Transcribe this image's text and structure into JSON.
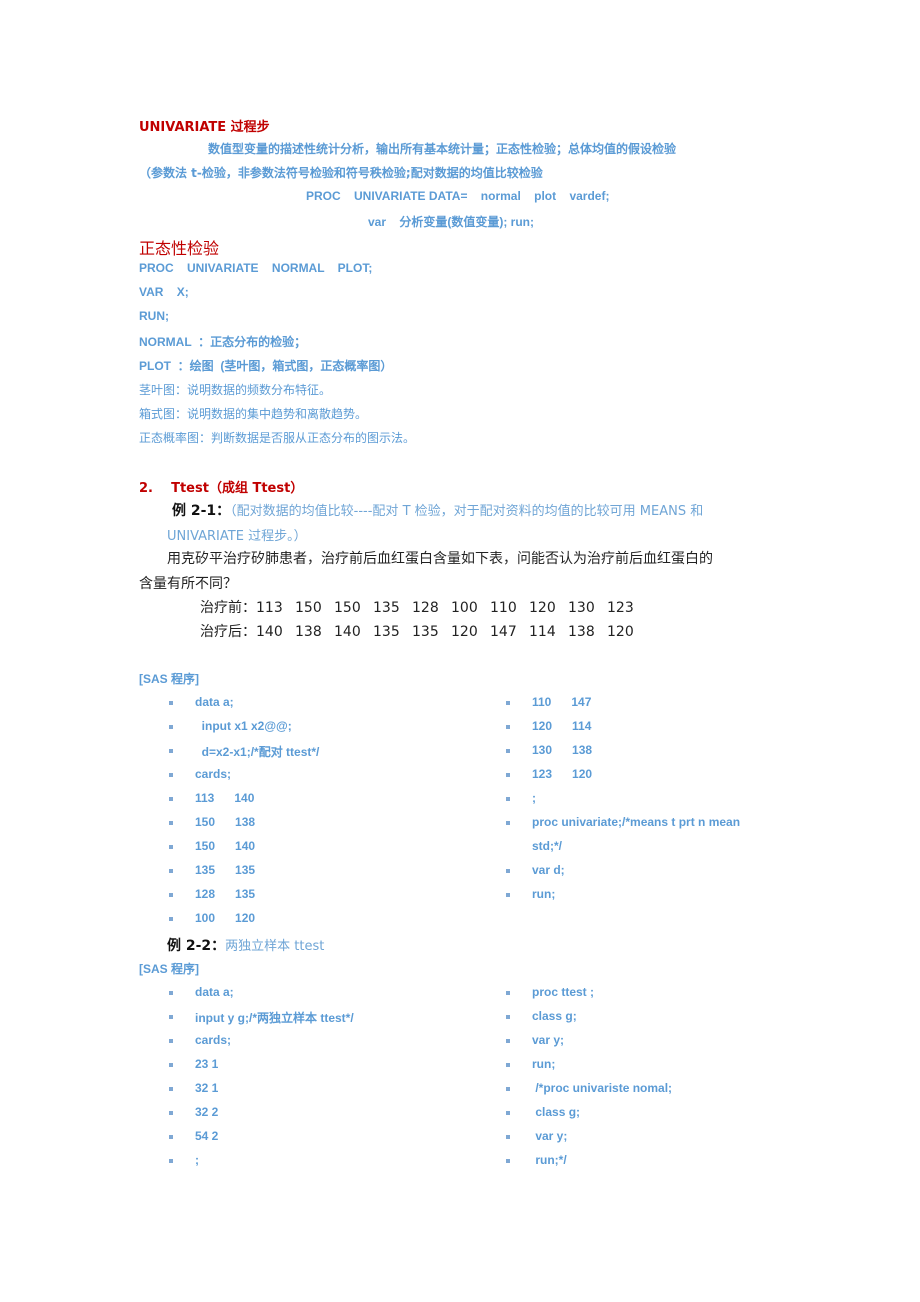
{
  "section1": {
    "title": "UNIVARIATE  过程步",
    "desc_line1": "数值型变量的描述性统计分析，输出所有基本统计量；正态性检验；总体均值的假设检验",
    "desc_line2": "（参数法 t-检验，非参数法符号检验和符号秩检验;配对数据的均值比较检验",
    "syntax_line1": "PROC    UNIVARIATE DATA=    normal    plot    vardef;",
    "syntax_line2": "var    分析变量(数值变量); run;"
  },
  "section_normal": {
    "title": "正态性检验",
    "lines": [
      "PROC    UNIVARIATE    NORMAL    PLOT;",
      "VAR    X;",
      "RUN;",
      "NORMAL  ：正态分布的检验；",
      "PLOT  ：绘图  (茎叶图，箱式图，正态概率图）",
      "茎叶图：说明数据的频数分布特征。",
      "箱式图：说明数据的集中趋势和离散趋势。",
      "正态概率图：判断数据是否服从正态分布的图示法。"
    ]
  },
  "section2": {
    "title": "2.    Ttest（成组 Ttest）",
    "example1": {
      "label": "例 2-1：",
      "desc_line1": "（配对数据的均值比较----配对 T 检验，对于配对资料的均值的比较可用 MEANS 和",
      "desc_line2": "UNIVARIATE 过程步。）",
      "question_line1": "用克矽平治疗矽肺患者，治疗前后血红蛋白含量如下表，问能否认为治疗前后血红蛋白的",
      "question_line2": "含量有所不同？",
      "before_label": "治疗前：",
      "before_values": [
        "113",
        "150",
        "150",
        "135",
        "128",
        "100",
        "110",
        "120",
        "130",
        "123"
      ],
      "after_label": "治疗后：",
      "after_values": [
        "140",
        "138",
        "140",
        "135",
        "135",
        "120",
        "147",
        "114",
        "138",
        "120"
      ],
      "program_label": "[SAS 程序]",
      "code_left": [
        "data a;",
        "  input x1 x2@@;",
        "  d=x2-x1;/*配对 ttest*/",
        "cards;",
        "113      140",
        "150      138",
        "150      140",
        "135      135",
        "128      135",
        "100      120"
      ],
      "code_right": [
        "110      147",
        "120      114",
        "130      138",
        "123      120",
        ";",
        "proc univariate;/*means t prt n mean",
        "std;*/",
        "var d;",
        "run;"
      ]
    },
    "example2": {
      "label": "例 2-2：",
      "desc": "两独立样本 ttest",
      "program_label": "[SAS 程序]",
      "code_left": [
        "data a;",
        "input y g;/*两独立样本 ttest*/",
        "cards;",
        "23 1",
        "32 1",
        "32 2",
        "54 2",
        ";"
      ],
      "code_right": [
        "proc ttest ;",
        "class g;",
        "var y;",
        "run;",
        " /*proc univariste nomal;",
        " class g;",
        " var y;",
        " run;*/"
      ]
    }
  }
}
